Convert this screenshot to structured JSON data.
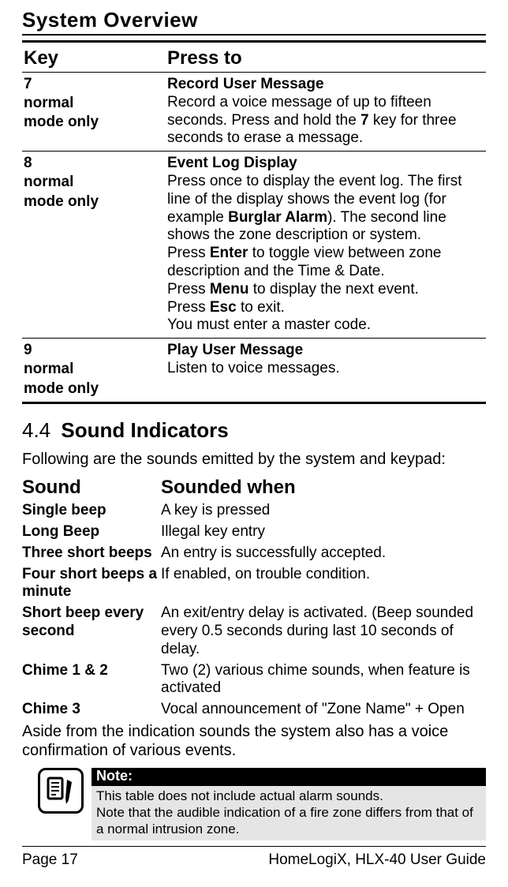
{
  "header": {
    "overview": "System Overview"
  },
  "keyTable": {
    "col1": "Key",
    "col2": "Press to",
    "rows": [
      {
        "keyNum": "7",
        "keyMode": "normal mode only",
        "title": "Record User Message",
        "body": "Record a voice message of up to fifteen seconds. Press and hold the 7 key for three seconds to erase a message."
      },
      {
        "keyNum": "8",
        "keyMode": "normal mode only",
        "title": "Event Log Display",
        "body": "Press once to display the event log. The first line of the display shows the event log (for example Burglar Alarm). The second line shows the zone description or system.\nPress Enter to toggle view between zone description and the Time & Date.\nPress Menu to display the next event.\nPress Esc to exit.\nYou must enter a master code."
      },
      {
        "keyNum": "9",
        "keyMode": "normal mode only",
        "title": "Play User Message",
        "body": "Listen to voice messages."
      }
    ]
  },
  "section": {
    "num": "4.4",
    "title": "Sound Indicators",
    "intro": "Following are the sounds emitted by the system and keypad:"
  },
  "soundTable": {
    "col1": "Sound",
    "col2": "Sounded when",
    "rows": [
      {
        "sound": "Single beep",
        "when": "A key is pressed"
      },
      {
        "sound": "Long Beep",
        "when": "Illegal key entry"
      },
      {
        "sound": "Three short beeps",
        "when": "An entry is successfully accepted."
      },
      {
        "sound": "Four short beeps a minute",
        "when": "If enabled, on trouble condition."
      },
      {
        "sound": "Short beep every second",
        "when": "An exit/entry delay is activated. (Beep sounded every 0.5 seconds during last 10 seconds of delay."
      },
      {
        "sound": "Chime 1 & 2",
        "when": "Two (2) various chime sounds, when feature is activated"
      },
      {
        "sound": "Chime 3",
        "when": "Vocal announcement  of \"Zone Name\" + Open"
      }
    ]
  },
  "aside": "Aside from the indication sounds the system also has a voice confirmation of various events.",
  "note": {
    "header": "Note:",
    "body": "This table does not include actual alarm sounds.\nNote that the audible indication of a fire zone differs from that of a normal intrusion zone."
  },
  "footer": {
    "left": "Page 17",
    "right": "HomeLogiX, HLX-40 User Guide"
  }
}
